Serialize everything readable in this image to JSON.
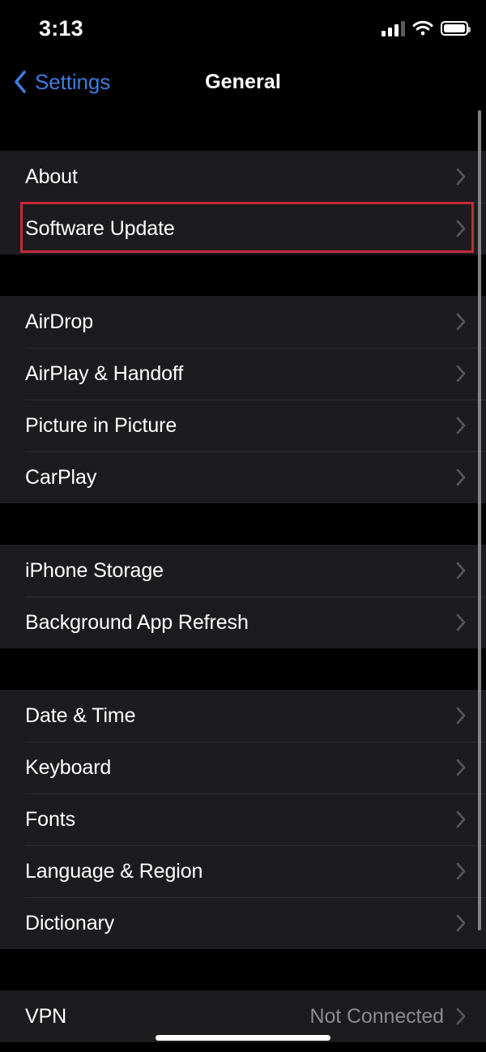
{
  "status_bar": {
    "time": "3:13",
    "icons": {
      "cellular": "signal-bars-icon",
      "wifi": "wifi-icon",
      "battery": "battery-icon"
    }
  },
  "nav": {
    "back_label": "Settings",
    "back_icon": "chevron-left-icon",
    "title": "General"
  },
  "colors": {
    "accent_blue": "#3f7ce0",
    "row_background": "#1c1c1e",
    "page_background": "#000000",
    "highlight_red": "#c32a3c",
    "secondary_text": "#8b8b90",
    "separator": "#2e2e30"
  },
  "highlight": {
    "target_row": "Software Update"
  },
  "sections": [
    {
      "rows": [
        {
          "label": "About",
          "value": "",
          "accessory": "chevron-right-icon",
          "highlighted": false
        },
        {
          "label": "Software Update",
          "value": "",
          "accessory": "chevron-right-icon",
          "highlighted": true
        }
      ]
    },
    {
      "rows": [
        {
          "label": "AirDrop",
          "value": "",
          "accessory": "chevron-right-icon",
          "highlighted": false
        },
        {
          "label": "AirPlay & Handoff",
          "value": "",
          "accessory": "chevron-right-icon",
          "highlighted": false
        },
        {
          "label": "Picture in Picture",
          "value": "",
          "accessory": "chevron-right-icon",
          "highlighted": false
        },
        {
          "label": "CarPlay",
          "value": "",
          "accessory": "chevron-right-icon",
          "highlighted": false
        }
      ]
    },
    {
      "rows": [
        {
          "label": "iPhone Storage",
          "value": "",
          "accessory": "chevron-right-icon",
          "highlighted": false
        },
        {
          "label": "Background App Refresh",
          "value": "",
          "accessory": "chevron-right-icon",
          "highlighted": false
        }
      ]
    },
    {
      "rows": [
        {
          "label": "Date & Time",
          "value": "",
          "accessory": "chevron-right-icon",
          "highlighted": false
        },
        {
          "label": "Keyboard",
          "value": "",
          "accessory": "chevron-right-icon",
          "highlighted": false
        },
        {
          "label": "Fonts",
          "value": "",
          "accessory": "chevron-right-icon",
          "highlighted": false
        },
        {
          "label": "Language & Region",
          "value": "",
          "accessory": "chevron-right-icon",
          "highlighted": false
        },
        {
          "label": "Dictionary",
          "value": "",
          "accessory": "chevron-right-icon",
          "highlighted": false
        }
      ]
    },
    {
      "rows": [
        {
          "label": "VPN",
          "value": "Not Connected",
          "accessory": "chevron-right-icon",
          "highlighted": false
        }
      ]
    }
  ]
}
